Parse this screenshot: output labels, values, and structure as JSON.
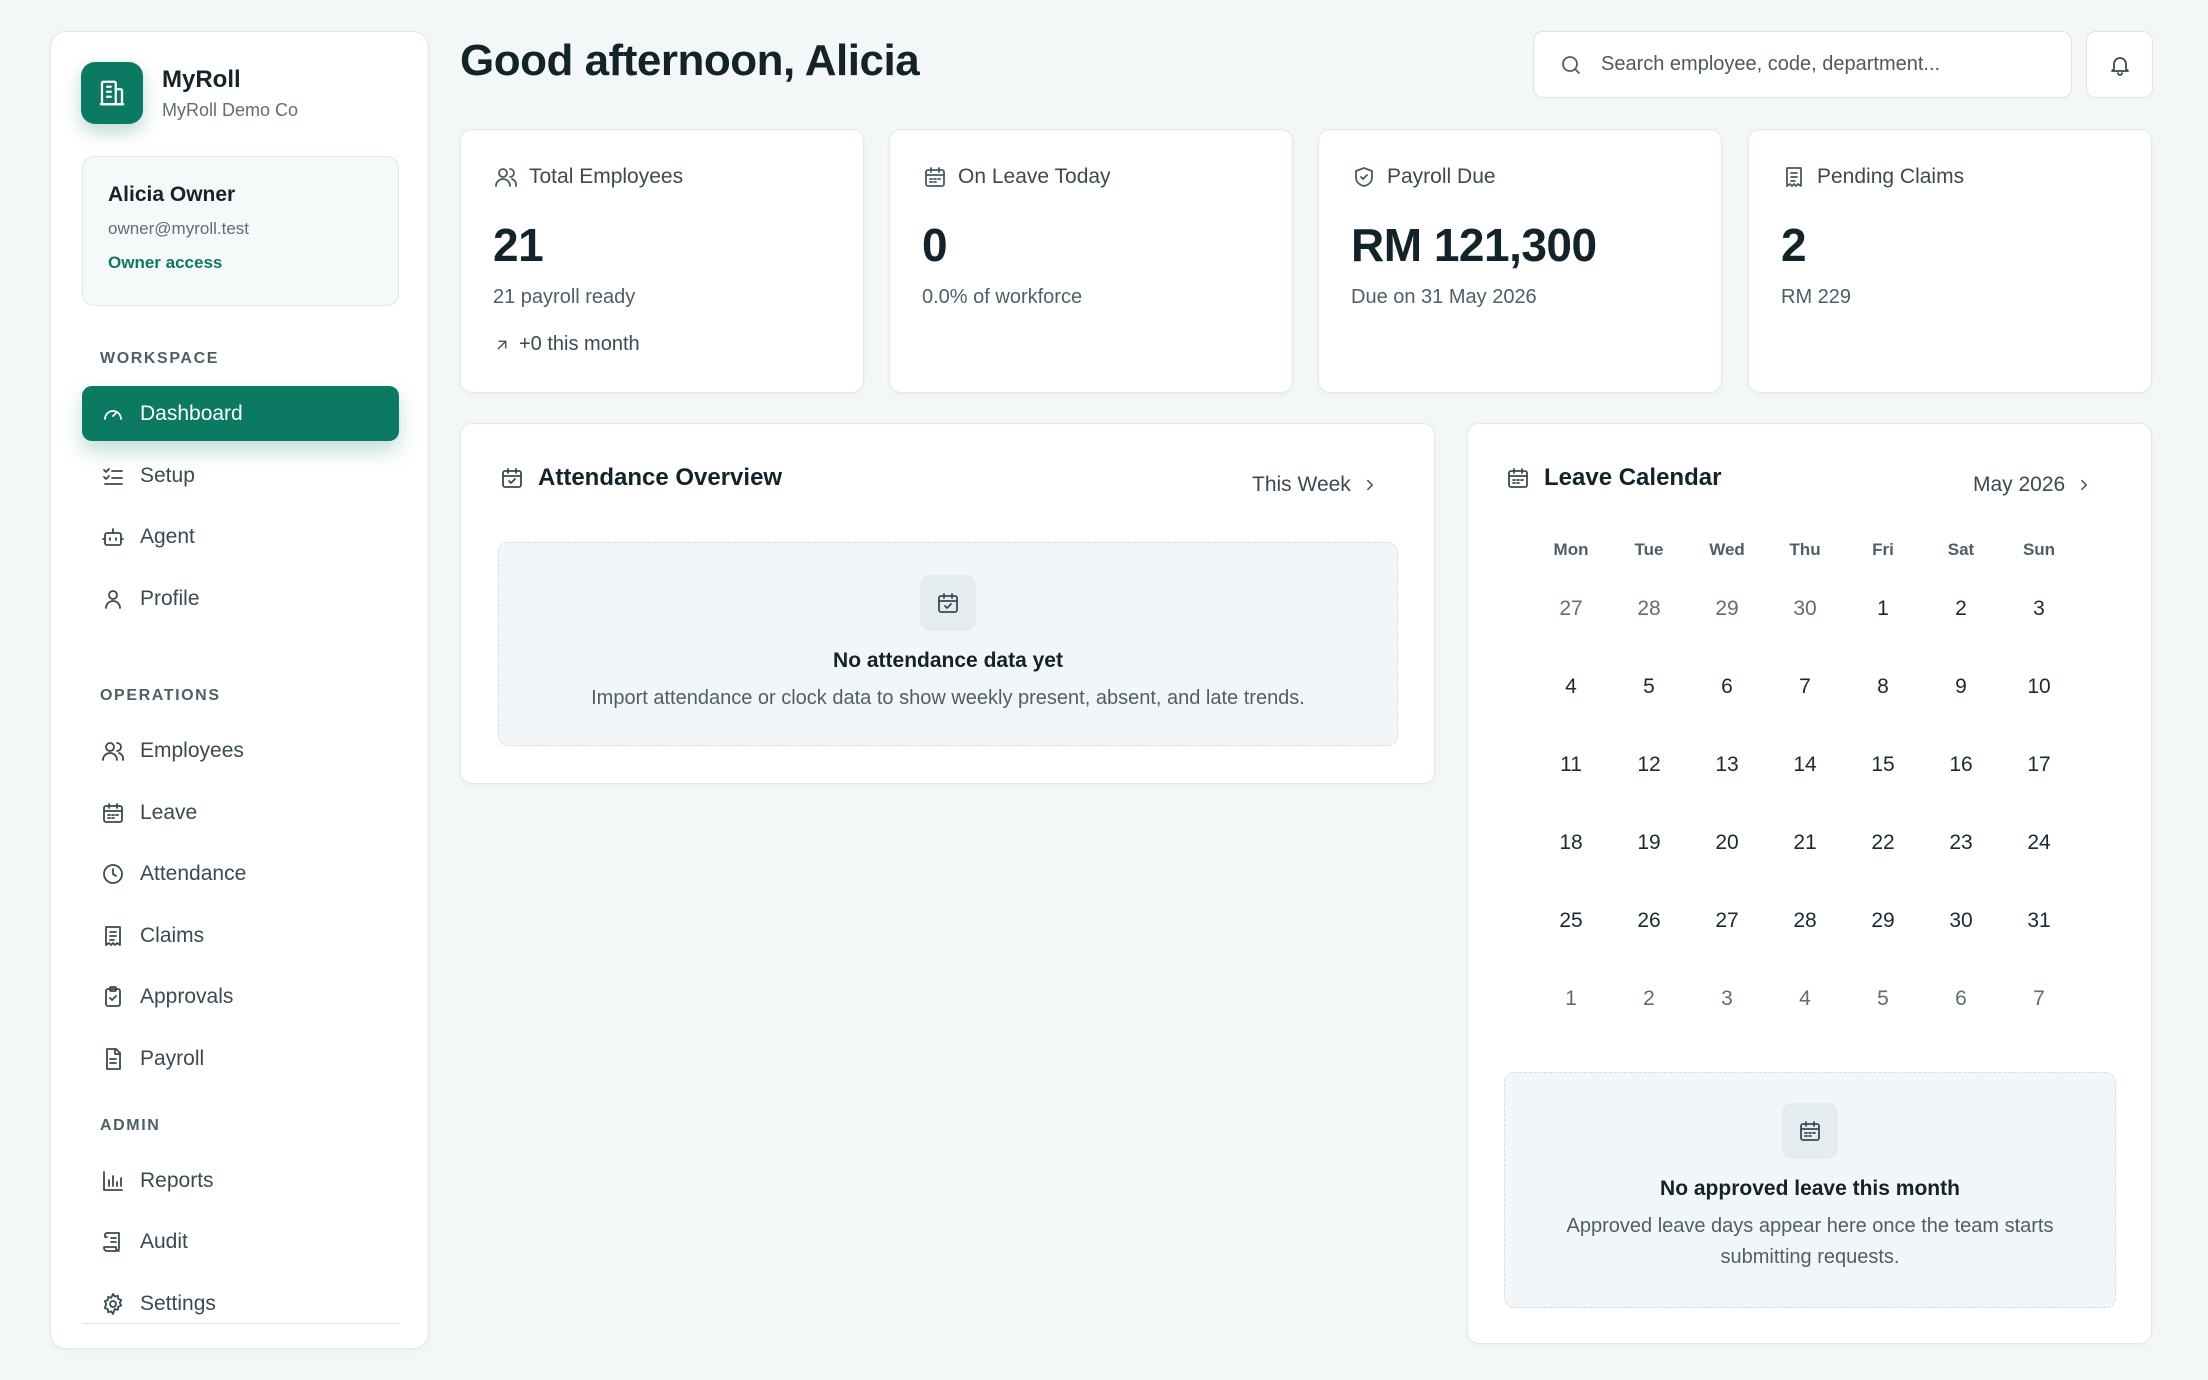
{
  "brand": {
    "name": "MyRoll",
    "company": "MyRoll Demo Co"
  },
  "user": {
    "name": "Alicia Owner",
    "email": "owner@myroll.test",
    "access": "Owner access"
  },
  "nav": {
    "workspace_label": "WORKSPACE",
    "operations_label": "OPERATIONS",
    "admin_label": "ADMIN",
    "items": [
      {
        "label": "Dashboard",
        "icon": "gauge-icon"
      },
      {
        "label": "Setup",
        "icon": "checklist-icon"
      },
      {
        "label": "Agent",
        "icon": "bot-icon"
      },
      {
        "label": "Profile",
        "icon": "user-icon"
      },
      {
        "label": "Employees",
        "icon": "users-icon"
      },
      {
        "label": "Leave",
        "icon": "calendar-icon"
      },
      {
        "label": "Attendance",
        "icon": "clock-icon"
      },
      {
        "label": "Claims",
        "icon": "receipt-icon"
      },
      {
        "label": "Approvals",
        "icon": "clipboard-check-icon"
      },
      {
        "label": "Payroll",
        "icon": "file-text-icon"
      },
      {
        "label": "Reports",
        "icon": "bar-chart-icon"
      },
      {
        "label": "Audit",
        "icon": "scroll-icon"
      },
      {
        "label": "Settings",
        "icon": "gear-icon"
      }
    ],
    "active": "Dashboard"
  },
  "header": {
    "greeting": "Good afternoon, Alicia",
    "search_placeholder": "Search employee, code, department..."
  },
  "stats": [
    {
      "label": "Total Employees",
      "value": "21",
      "sub": "21 payroll ready",
      "trend": "+0 this month",
      "icon": "users-icon"
    },
    {
      "label": "On Leave Today",
      "value": "0",
      "sub": "0.0% of workforce",
      "icon": "calendar-icon"
    },
    {
      "label": "Payroll Due",
      "value": "RM 121,300",
      "sub": "Due on 31 May 2026",
      "icon": "shield-check-icon"
    },
    {
      "label": "Pending Claims",
      "value": "2",
      "sub": "RM 229",
      "icon": "receipt-icon"
    }
  ],
  "attendance": {
    "title": "Attendance Overview",
    "range": "This Week",
    "empty_title": "No attendance data yet",
    "empty_text": "Import attendance or clock data to show weekly present, absent, and late trends."
  },
  "calendar": {
    "title": "Leave Calendar",
    "month": "May 2026",
    "weekdays": [
      "Mon",
      "Tue",
      "Wed",
      "Thu",
      "Fri",
      "Sat",
      "Sun"
    ],
    "weeks": [
      [
        "27",
        "28",
        "29",
        "30",
        "1",
        "2",
        "3"
      ],
      [
        "4",
        "5",
        "6",
        "7",
        "8",
        "9",
        "10"
      ],
      [
        "11",
        "12",
        "13",
        "14",
        "15",
        "16",
        "17"
      ],
      [
        "18",
        "19",
        "20",
        "21",
        "22",
        "23",
        "24"
      ],
      [
        "25",
        "26",
        "27",
        "28",
        "29",
        "30",
        "31"
      ],
      [
        "1",
        "2",
        "3",
        "4",
        "5",
        "6",
        "7"
      ]
    ],
    "empty_title": "No approved leave this month",
    "empty_text": "Approved leave days appear here once the team starts submitting requests."
  },
  "colors": {
    "accent": "#0c7a62",
    "background": "#f3f7f8"
  }
}
